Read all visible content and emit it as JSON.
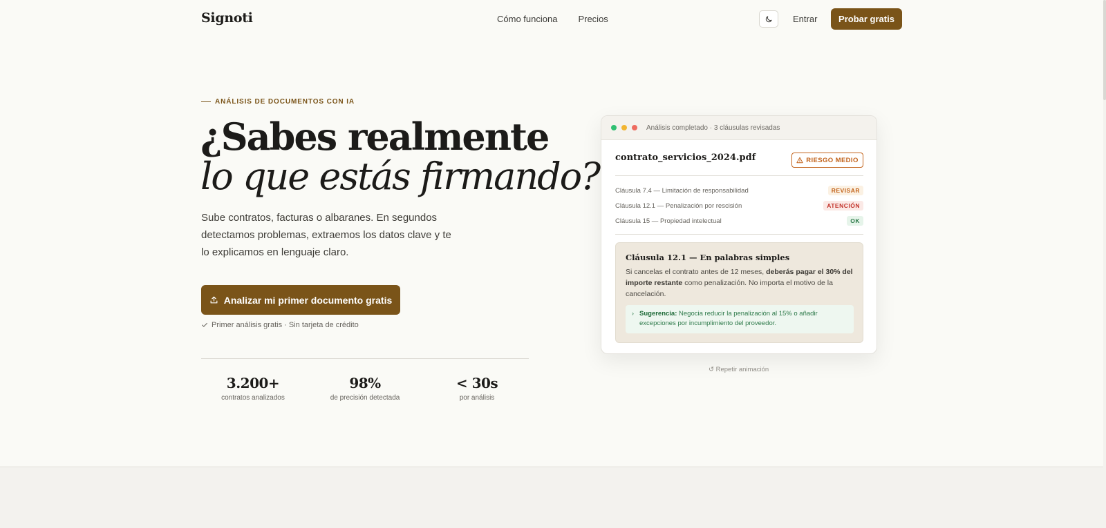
{
  "nav": {
    "logo": "Signoti",
    "links": [
      "Cómo funciona",
      "Precios"
    ],
    "login": "Entrar",
    "cta": "Probar gratis",
    "theme_icon": "moon-icon"
  },
  "hero": {
    "eyebrow": "ANÁLISIS DE DOCUMENTOS CON IA",
    "headline_line1": "¿Sabes realmente",
    "headline_line2": "lo que estás firmando?",
    "lead": "Sube contratos, facturas o albaranes. En segundos detectamos problemas, extraemos los datos clave y te lo explicamos en lenguaje claro.",
    "cta": "Analizar mi primer documento gratis",
    "cta_icon": "upload-icon",
    "note": "Primer análisis gratis · Sin tarjeta de crédito",
    "stats": [
      {
        "value": "3.200+",
        "label": "contratos analizados"
      },
      {
        "value": "98%",
        "label": "de precisión detectada"
      },
      {
        "value": "< 30s",
        "label": "por análisis"
      }
    ]
  },
  "card": {
    "status": "Análisis completado · 3 cláusulas revisadas",
    "filename": "contrato_servicios_2024.pdf",
    "risk": "RIESGO MEDIO",
    "clauses": [
      {
        "text": "Cláusula 7.4 — Limitación de responsabilidad",
        "tag": "REVISAR",
        "color": "#c2621a",
        "bg": "#fbf1e3"
      },
      {
        "text": "Cláusula 12.1 — Penalización por rescisión",
        "tag": "ATENCIÓN",
        "color": "#c2322a",
        "bg": "#fbe9e6"
      },
      {
        "text": "Cláusula 15 — Propiedad intelectual",
        "tag": "OK",
        "color": "#2e7a4a",
        "bg": "#e6f4ea"
      }
    ],
    "explain_title": "Cláusula 12.1 — En palabras simples",
    "explain_pre": "Si cancelas el contrato antes de 12 meses, ",
    "explain_bold": "deberás pagar el 30% del importe restante",
    "explain_post": " como penalización. No importa el motivo de la cancelación.",
    "suggest_label": "Sugerencia:",
    "suggest_text": " Negocia reducir la penalización al 15% o añadir excepciones por incumplimiento del proveedor.",
    "repeat": "↺ Repetir animación"
  },
  "colors": {
    "accent": "#7a5419",
    "background": "#fafaf6"
  }
}
